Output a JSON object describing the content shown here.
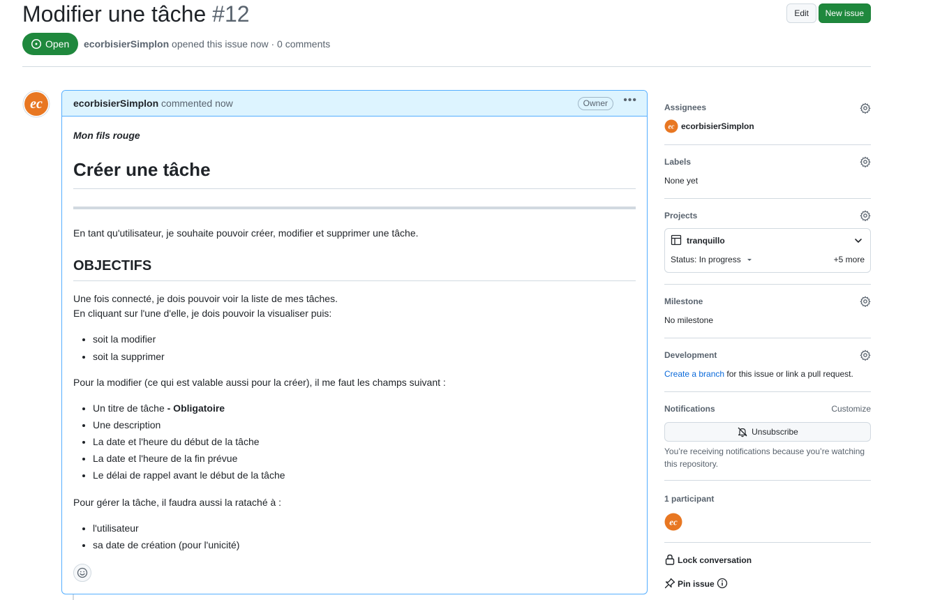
{
  "issue": {
    "title": "Modifier une tâche",
    "number": "#12",
    "state": "Open",
    "author": "ecorbisierSimplon",
    "meta_rest": "opened this issue now · 0 comments"
  },
  "actions": {
    "edit": "Edit",
    "new_issue": "New issue"
  },
  "comment": {
    "author": "ecorbisierSimplon",
    "when": "commented now",
    "badge": "Owner",
    "body": {
      "subtitle": "Mon fils rouge",
      "heading": "Créer une tâche",
      "intro": "En tant qu'utilisateur, je souhaite pouvoir créer, modifier et supprimer une tâche.",
      "objectives_heading": "OBJECTIFS",
      "objectives_line1": "Une fois connecté, je dois pouvoir voir la liste de mes tâches.",
      "objectives_line2": "En cliquant sur l'une d'elle, je dois pouvoir la visualiser puis:",
      "actions_list": [
        "soit la modifier",
        "soit la supprimer"
      ],
      "fields_intro": "Pour la modifier (ce qui est valable aussi pour la créer), il me faut les champs suivant :",
      "field_title": "Un titre de tâche",
      "field_title_req": "- Obligatoire",
      "fields_list": [
        "Une description",
        "La date et l'heure du début de la tâche",
        "La date et l'heure de la fin prévue",
        "Le délai de rappel avant le début de la tâche"
      ],
      "manage_intro": "Pour gérer la tâche, il faudra aussi la rataché à :",
      "manage_list": [
        "l'utilisateur",
        "sa date de création (pour l'unicité)"
      ]
    }
  },
  "sidebar": {
    "assignees": {
      "title": "Assignees",
      "user": "ecorbisierSimplon"
    },
    "labels": {
      "title": "Labels",
      "value": "None yet"
    },
    "projects": {
      "title": "Projects",
      "name": "tranquillo",
      "status": "Status: In progress",
      "more": "+5 more"
    },
    "milestone": {
      "title": "Milestone",
      "value": "No milestone"
    },
    "development": {
      "title": "Development",
      "link": "Create a branch",
      "rest": "for this issue or link a pull request."
    },
    "notifications": {
      "title": "Notifications",
      "customize": "Customize",
      "button": "Unsubscribe",
      "note": "You’re receiving notifications because you’re watching this repository."
    },
    "participants": {
      "title": "1 participant"
    },
    "lock": "Lock conversation",
    "pin": "Pin issue"
  },
  "colors": {
    "open_green": "#1f883d",
    "avatar_orange": "#e87722",
    "link_blue": "#0969da",
    "comment_border": "#54aeff",
    "comment_header": "#ddf4ff"
  },
  "icons": [
    "issue-opened-icon",
    "kebab-horizontal-icon",
    "smiley-icon",
    "gear-icon",
    "table-icon",
    "chevron-down-icon",
    "triangle-down-icon",
    "bell-slash-icon",
    "lock-icon",
    "pin-icon",
    "info-icon"
  ]
}
